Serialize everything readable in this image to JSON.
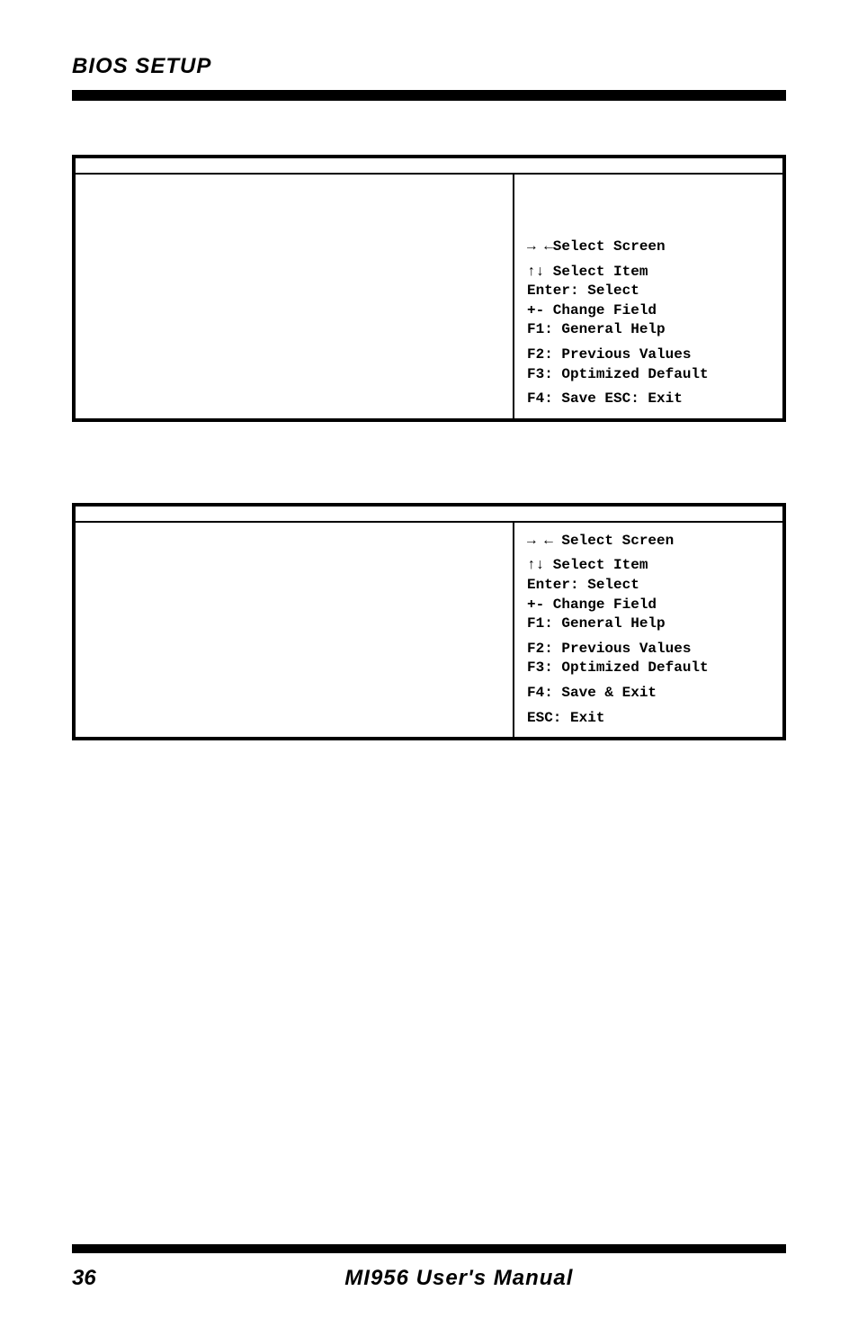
{
  "header": {
    "title": "BIOS SETUP"
  },
  "box1": {
    "right": {
      "select_screen": "→ ←Select Screen",
      "select_item": "↑↓ Select Item",
      "enter": "Enter: Select",
      "change_field": "+-  Change Field",
      "f1": "F1: General Help",
      "f2": "F2: Previous Values",
      "f3": "F3: Optimized Default",
      "f4": "F4: Save  ESC: Exit"
    }
  },
  "box2": {
    "right": {
      "select_screen": " → ←   Select Screen",
      "select_item": "↑↓ Select Item",
      "enter": "Enter: Select",
      "change_field": "+-  Change Field",
      "f1": "F1: General Help",
      "f2": "F2: Previous Values",
      "f3": "F3: Optimized Default",
      "f4": "F4: Save & Exit",
      "esc": "ESC: Exit"
    }
  },
  "footer": {
    "page": "36",
    "title": "MI956 User's Manual"
  }
}
